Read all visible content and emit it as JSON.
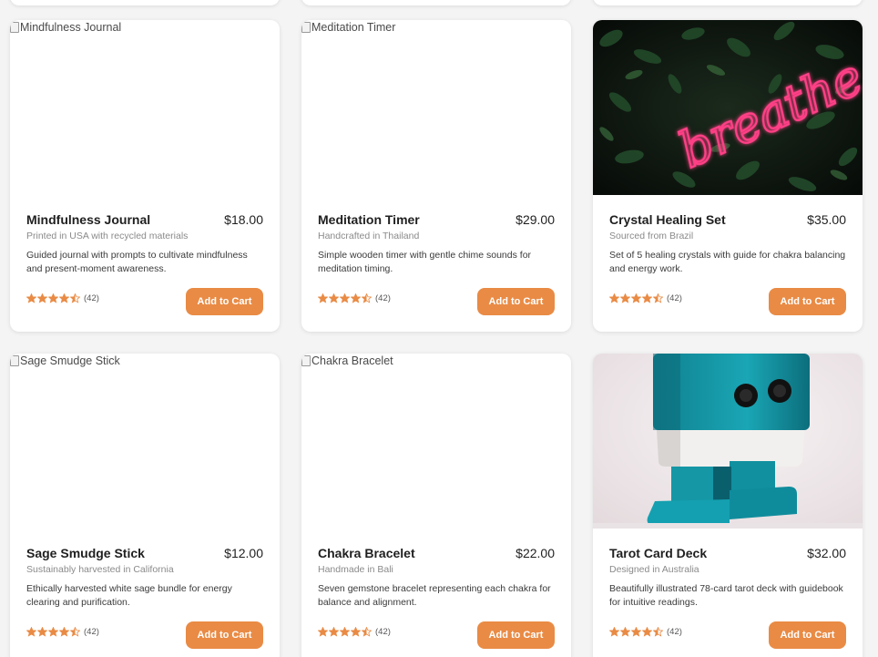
{
  "accent_color": "#e98b45",
  "products": [
    {
      "name": "Mindfulness Journal",
      "price": "$18.00",
      "origin": "Printed in USA with recycled materials",
      "description": "Guided journal with prompts to cultivate mindfulness and present-moment awareness.",
      "image_alt": "Mindfulness Journal",
      "image_type": "broken",
      "rating": 4.5,
      "rating_count": "(42)",
      "button_label": "Add to Cart"
    },
    {
      "name": "Meditation Timer",
      "price": "$29.00",
      "origin": "Handcrafted in Thailand",
      "description": "Simple wooden timer with gentle chime sounds for meditation timing.",
      "image_alt": "Meditation Timer",
      "image_type": "broken",
      "rating": 4.5,
      "rating_count": "(42)",
      "button_label": "Add to Cart"
    },
    {
      "name": "Crystal Healing Set",
      "price": "$35.00",
      "origin": "Sourced from Brazil",
      "description": "Set of 5 healing crystals with guide for chakra balancing and energy work.",
      "image_alt": "breathe",
      "image_type": "neon-breathe-photo",
      "rating": 4.5,
      "rating_count": "(42)",
      "button_label": "Add to Cart"
    },
    {
      "name": "Sage Smudge Stick",
      "price": "$12.00",
      "origin": "Sustainably harvested in California",
      "description": "Ethically harvested white sage bundle for energy clearing and purification.",
      "image_alt": "Sage Smudge Stick",
      "image_type": "broken",
      "rating": 4.5,
      "rating_count": "(42)",
      "button_label": "Add to Cart"
    },
    {
      "name": "Chakra Bracelet",
      "price": "$22.00",
      "origin": "Handmade in Bali",
      "description": "Seven gemstone bracelet representing each chakra for balance and alignment.",
      "image_alt": "Chakra Bracelet",
      "image_type": "broken",
      "rating": 4.5,
      "rating_count": "(42)",
      "button_label": "Add to Cart"
    },
    {
      "name": "Tarot Card Deck",
      "price": "$32.00",
      "origin": "Designed in Australia",
      "description": "Beautifully illustrated 78-card tarot deck with guidebook for intuitive readings.",
      "image_alt": "",
      "image_type": "teal-robot-photo",
      "rating": 4.5,
      "rating_count": "(42)",
      "button_label": "Add to Cart"
    }
  ]
}
